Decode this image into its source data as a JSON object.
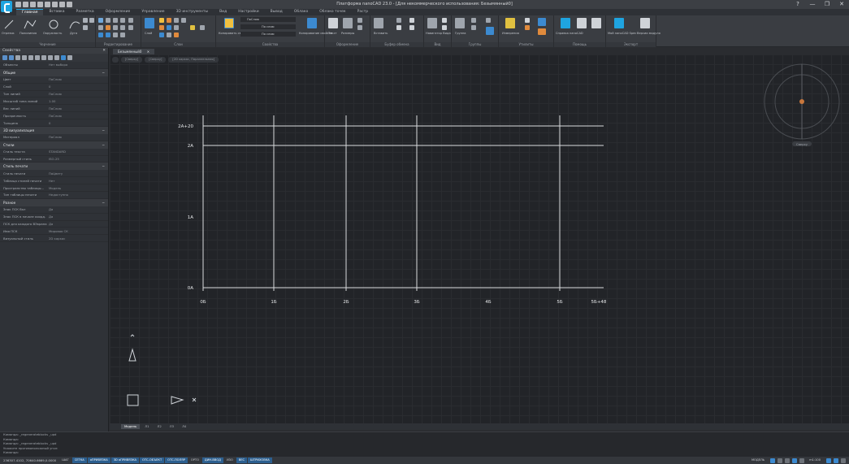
{
  "window": {
    "title": "Платформа nanoCAD 23.0 - [Для некоммерческого использования: Безымянный0]",
    "controls": [
      "?",
      "—",
      "❐",
      "✕"
    ]
  },
  "ribbon_tabs": [
    "Главная",
    "Вставка",
    "Разметка",
    "Оформление",
    "Управление",
    "3D инструменты",
    "Вид",
    "Настройки",
    "Вывод",
    "Облако",
    "Облако точек",
    "Растр"
  ],
  "ribbon_groups": [
    {
      "label": "Черчение",
      "buttons": [
        "Отрезок",
        "Полилиния",
        "Окружность",
        "Дуга"
      ]
    },
    {
      "label": "Редактирование",
      "buttons": []
    },
    {
      "label": "Слои",
      "buttons": [
        "Слой"
      ]
    },
    {
      "label": "Свойства",
      "buttons": [
        "Копировать свойства",
        "Копирование свойств"
      ],
      "props": [
        "ПоСлою",
        "По слою",
        "По слою"
      ]
    },
    {
      "label": "Оформление",
      "buttons": [
        "Текст",
        "Размеры"
      ]
    },
    {
      "label": "Буфер обмена",
      "buttons": [
        "Вставить"
      ]
    },
    {
      "label": "Вид",
      "buttons": [
        "Навигатор Вида"
      ]
    },
    {
      "label": "Группы",
      "buttons": [
        "Группа"
      ]
    },
    {
      "label": "Утилиты",
      "buttons": [
        "Измерения"
      ]
    },
    {
      "label": "Помощь",
      "buttons": [
        "Справка nanoCAD"
      ]
    },
    {
      "label": "Экспорт",
      "buttons": [
        "Мой nanoCAD Spec",
        "Версии модуля"
      ]
    }
  ],
  "properties": {
    "header": "Свойства",
    "object": [
      "Объекты",
      "Нет выбора"
    ],
    "sections": [
      {
        "title": "Общие",
        "rows": [
          [
            "Цвет",
            "ПоСлою"
          ],
          [
            "Слой",
            "0"
          ],
          [
            "Тип линий",
            "ПоСлою"
          ],
          [
            "Масштаб типа линий",
            "1.00"
          ],
          [
            "Вес линий",
            "ПоСлою"
          ],
          [
            "Прозрачность",
            "ПоСлою"
          ],
          [
            "Толщина",
            "0"
          ]
        ]
      },
      {
        "title": "3D визуализация",
        "rows": [
          [
            "Материал",
            "ПоСлою"
          ]
        ]
      },
      {
        "title": "Стили",
        "rows": [
          [
            "Стиль текста",
            "STANDARD"
          ],
          [
            "Размерный стиль",
            "ISO-25"
          ]
        ]
      },
      {
        "title": "Стиль печати",
        "rows": [
          [
            "Стиль печати",
            "ПоЦвету"
          ],
          [
            "Таблица стилей печати",
            "Нет"
          ],
          [
            "Пространство таблицы...",
            "Модель"
          ],
          [
            "Тип таблицы печати",
            "Недоступно"
          ]
        ]
      },
      {
        "title": "Разное",
        "rows": [
          [
            "Знак ПСК Вкл",
            "Да"
          ],
          [
            "Знак ПСК в начале коорд.",
            "Да"
          ],
          [
            "ПСК для каждого ВЭкрана",
            "Да"
          ],
          [
            "Имя ПСК",
            "Мировая СК"
          ],
          [
            "Визуальный стиль",
            "2D каркас"
          ]
        ]
      }
    ]
  },
  "document_tab": "Безымянный0",
  "breadcrumbs": [
    "[Сверху]",
    "[Сверху]",
    "[2D каркас, Параллельная]"
  ],
  "grid": {
    "x_labels": [
      "0Б",
      "1Б",
      "2Б",
      "3Б",
      "4Б",
      "5Б",
      "5Б+48"
    ],
    "y_labels": [
      "2А+20",
      "2А",
      "1А",
      "0А"
    ]
  },
  "viewcube_label": "Сверху",
  "layout_tabs": [
    "Модель",
    "Л1",
    "Л2",
    "Л3",
    "Л4"
  ],
  "command_lines": [
    "Команда: _regenerateblocks _upd",
    "Команда:",
    "Команда: _regenerateblocks _upd",
    "Укажите противоположный угол:",
    "Команда:"
  ],
  "status": {
    "coords": "236307.4102, 70640.6669,0.0000",
    "buttons": [
      {
        "label": "ШАГ",
        "on": false
      },
      {
        "label": "СЕТКА",
        "on": true
      },
      {
        "label": "оПРИВЯЗКА",
        "on": true
      },
      {
        "label": "3D оПРИВЯЗКА",
        "on": true
      },
      {
        "label": "ОТС-ОБЪЕКТ",
        "on": true
      },
      {
        "label": "ОТС-ПОЛЯР",
        "on": true
      },
      {
        "label": "ОРТО",
        "on": false
      },
      {
        "label": "ДИН-ВВОД",
        "on": true
      },
      {
        "label": "ИЗО",
        "on": false
      },
      {
        "label": "ВЕС",
        "on": true
      },
      {
        "label": "ШТРИХОВКА",
        "on": true
      }
    ],
    "right_label": "МОДЕЛЬ",
    "scale": "m1:100"
  }
}
